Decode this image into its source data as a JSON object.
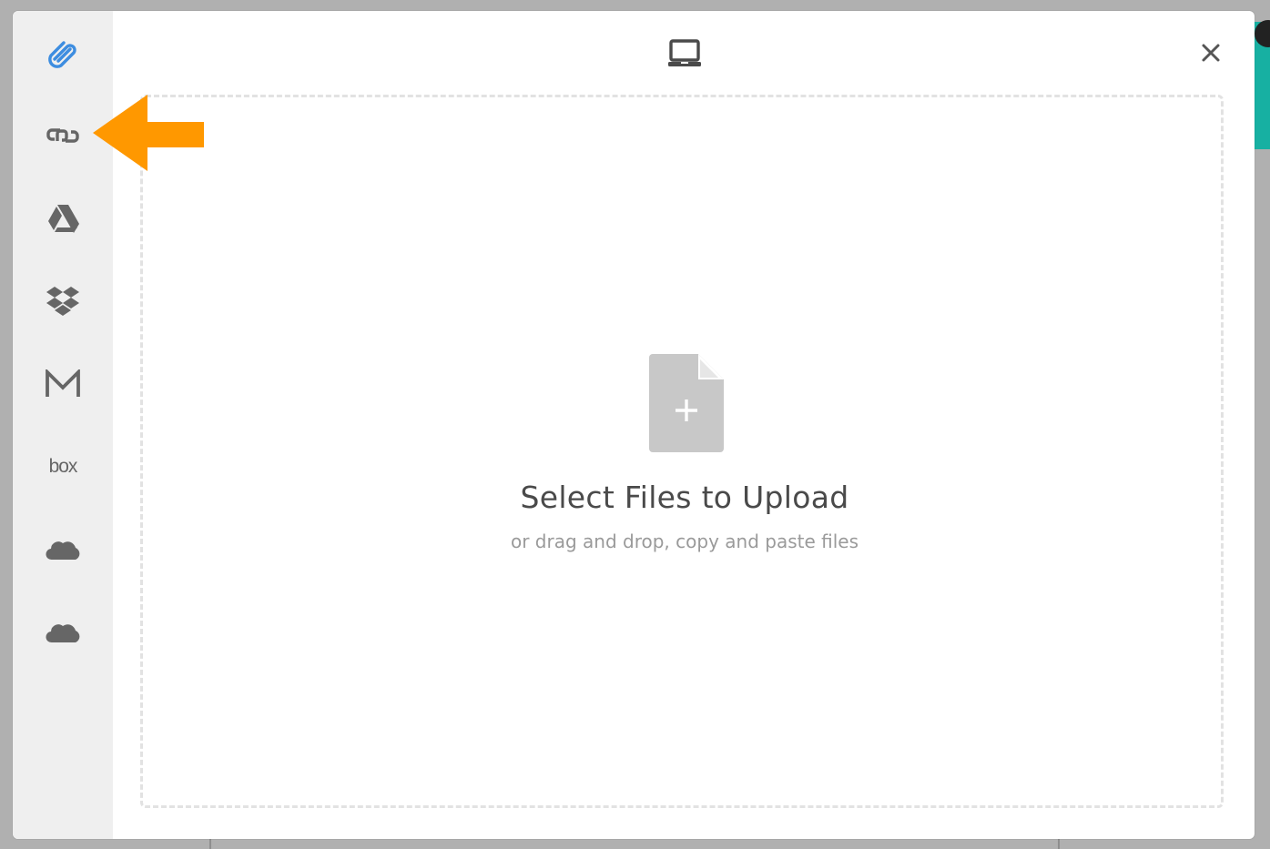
{
  "modal": {
    "header_icon": "laptop-icon",
    "close_icon": "close-icon"
  },
  "sidebar": {
    "items": [
      {
        "name": "attachment",
        "icon": "paperclip-icon",
        "active": true
      },
      {
        "name": "link",
        "icon": "link-icon"
      },
      {
        "name": "google-drive",
        "icon": "google-drive-icon"
      },
      {
        "name": "dropbox",
        "icon": "dropbox-icon"
      },
      {
        "name": "gmail",
        "icon": "gmail-icon"
      },
      {
        "name": "box",
        "icon": "box-logo",
        "label": "box"
      },
      {
        "name": "onedrive",
        "icon": "cloud-icon"
      },
      {
        "name": "onedrive-business",
        "icon": "cloud-icon"
      }
    ]
  },
  "dropzone": {
    "title": "Select Files to Upload",
    "subtitle": "or drag and drop, copy and paste files",
    "icon": "file-plus-icon"
  },
  "annotation": {
    "icon": "orange-arrow-icon",
    "color": "#ff9800",
    "points_to": "link"
  },
  "colors": {
    "accent": "#3d8de0",
    "icon": "#666666",
    "arrow": "#ff9800"
  }
}
